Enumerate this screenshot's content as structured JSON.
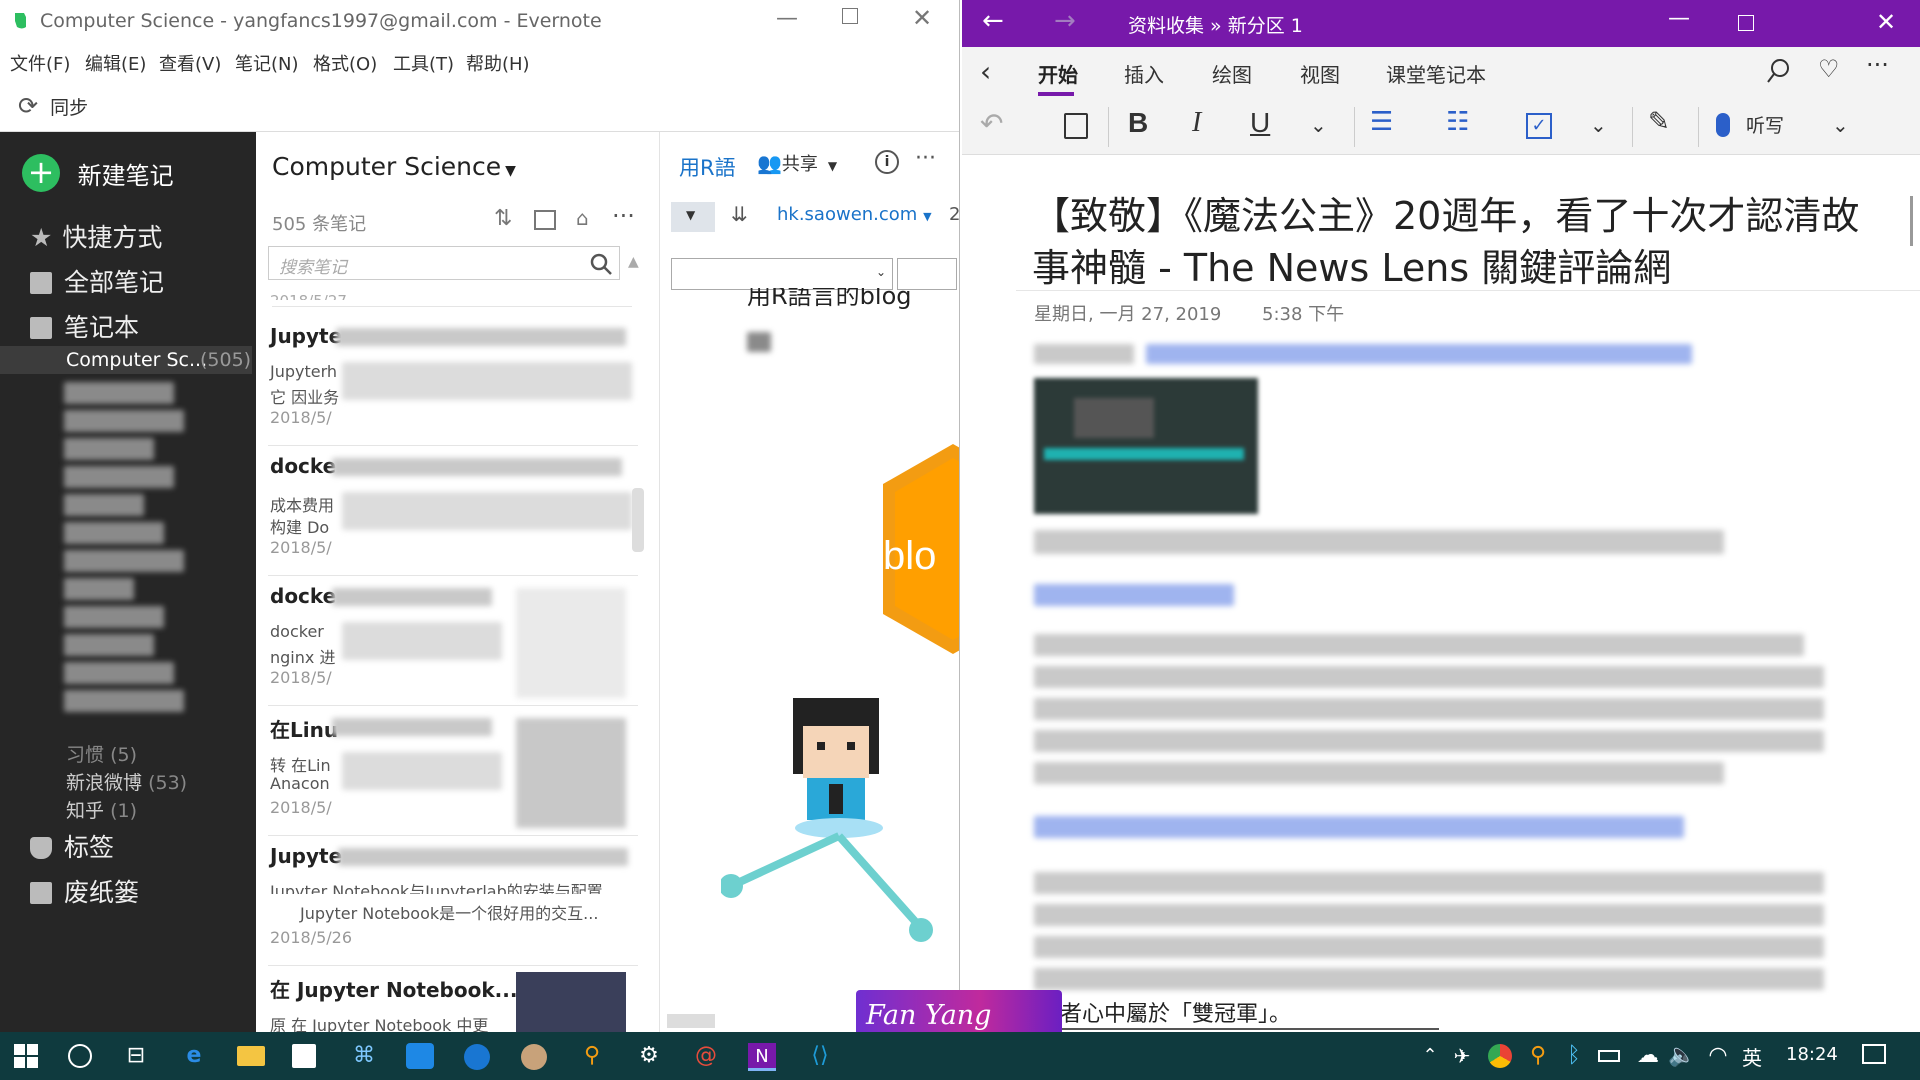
{
  "evernote": {
    "title": "Computer Science - yangfancs1997@gmail.com - Evernote",
    "menu": [
      "文件(F)",
      "编辑(E)",
      "查看(V)",
      "笔记(N)",
      "格式(O)",
      "工具(T)",
      "帮助(H)"
    ],
    "sync_label": "同步",
    "new_note_label": "新建笔记",
    "sidebar": {
      "shortcuts": "快捷方式",
      "all_notes": "全部笔记",
      "notebooks": "笔记本",
      "selected_notebook": "Computer Sc...",
      "selected_count": "(505)",
      "nb_xiguan": "习惯",
      "nb_xiguan_count": "(5)",
      "nb_weibo": "新浪微博",
      "nb_weibo_count": "(53)",
      "nb_zhihu": "知乎",
      "nb_zhihu_count": "(1)",
      "tags": "标签",
      "trash": "废纸篓"
    },
    "list": {
      "header": "Computer Science",
      "count": "505 条笔记",
      "search_placeholder": "搜索笔记",
      "top_date": "2018/5/27",
      "notes": [
        {
          "title": "Jupyte",
          "line1": "Jupyterh",
          "line2": "它 因业务",
          "date": "2018/5/"
        },
        {
          "title": "docke",
          "line1": "成本费用",
          "line2": "构建 Do",
          "date": "2018/5/"
        },
        {
          "title": "docke",
          "line1": "docker",
          "line2": "nginx 进",
          "date": "2018/5/"
        },
        {
          "title": "在Linu",
          "line1": "转 在Lin",
          "line2": "Anacon",
          "date": "2018/5/"
        },
        {
          "title": "Jupyte",
          "line1": "Jupyter Notebook与Jupyterlab的安装与配置",
          "line2": "Jupyter Notebook是一个很好用的交互...",
          "date": "2018/5/26"
        },
        {
          "title": "在 Jupyter Notebook...",
          "line1": "原 在 Jupyter Notebook 中更",
          "line2": "",
          "date": ""
        }
      ]
    },
    "view": {
      "notebook_label": "用R語",
      "share_label": "共享",
      "source_url": "hk.saowen.com",
      "page_number": "2",
      "blog_text": "用R語言的blog",
      "blo_text": "blo"
    }
  },
  "onenote": {
    "breadcrumb": "资料收集 » 新分区 1",
    "tabs": [
      "开始",
      "插入",
      "绘图",
      "视图",
      "课堂笔记本"
    ],
    "dictate_label": "听写",
    "page_title_line1": "【致敬】《魔法公主》20週年，看了十次才認清故",
    "page_title_line2": "事神髓 - The News Lens 關鍵評論網",
    "date": "星期日, 一月 27, 2019",
    "time": "5:38 下午",
    "bottom_text": "者心中屬於「雙冠軍」。"
  },
  "watermark": "Fan Yang",
  "taskbar": {
    "ime": "英",
    "clock": "18:24"
  },
  "colors": {
    "evernote_green": "#2dbe60",
    "onenote_purple": "#7719aa",
    "taskbar": "#0f3a3e"
  }
}
